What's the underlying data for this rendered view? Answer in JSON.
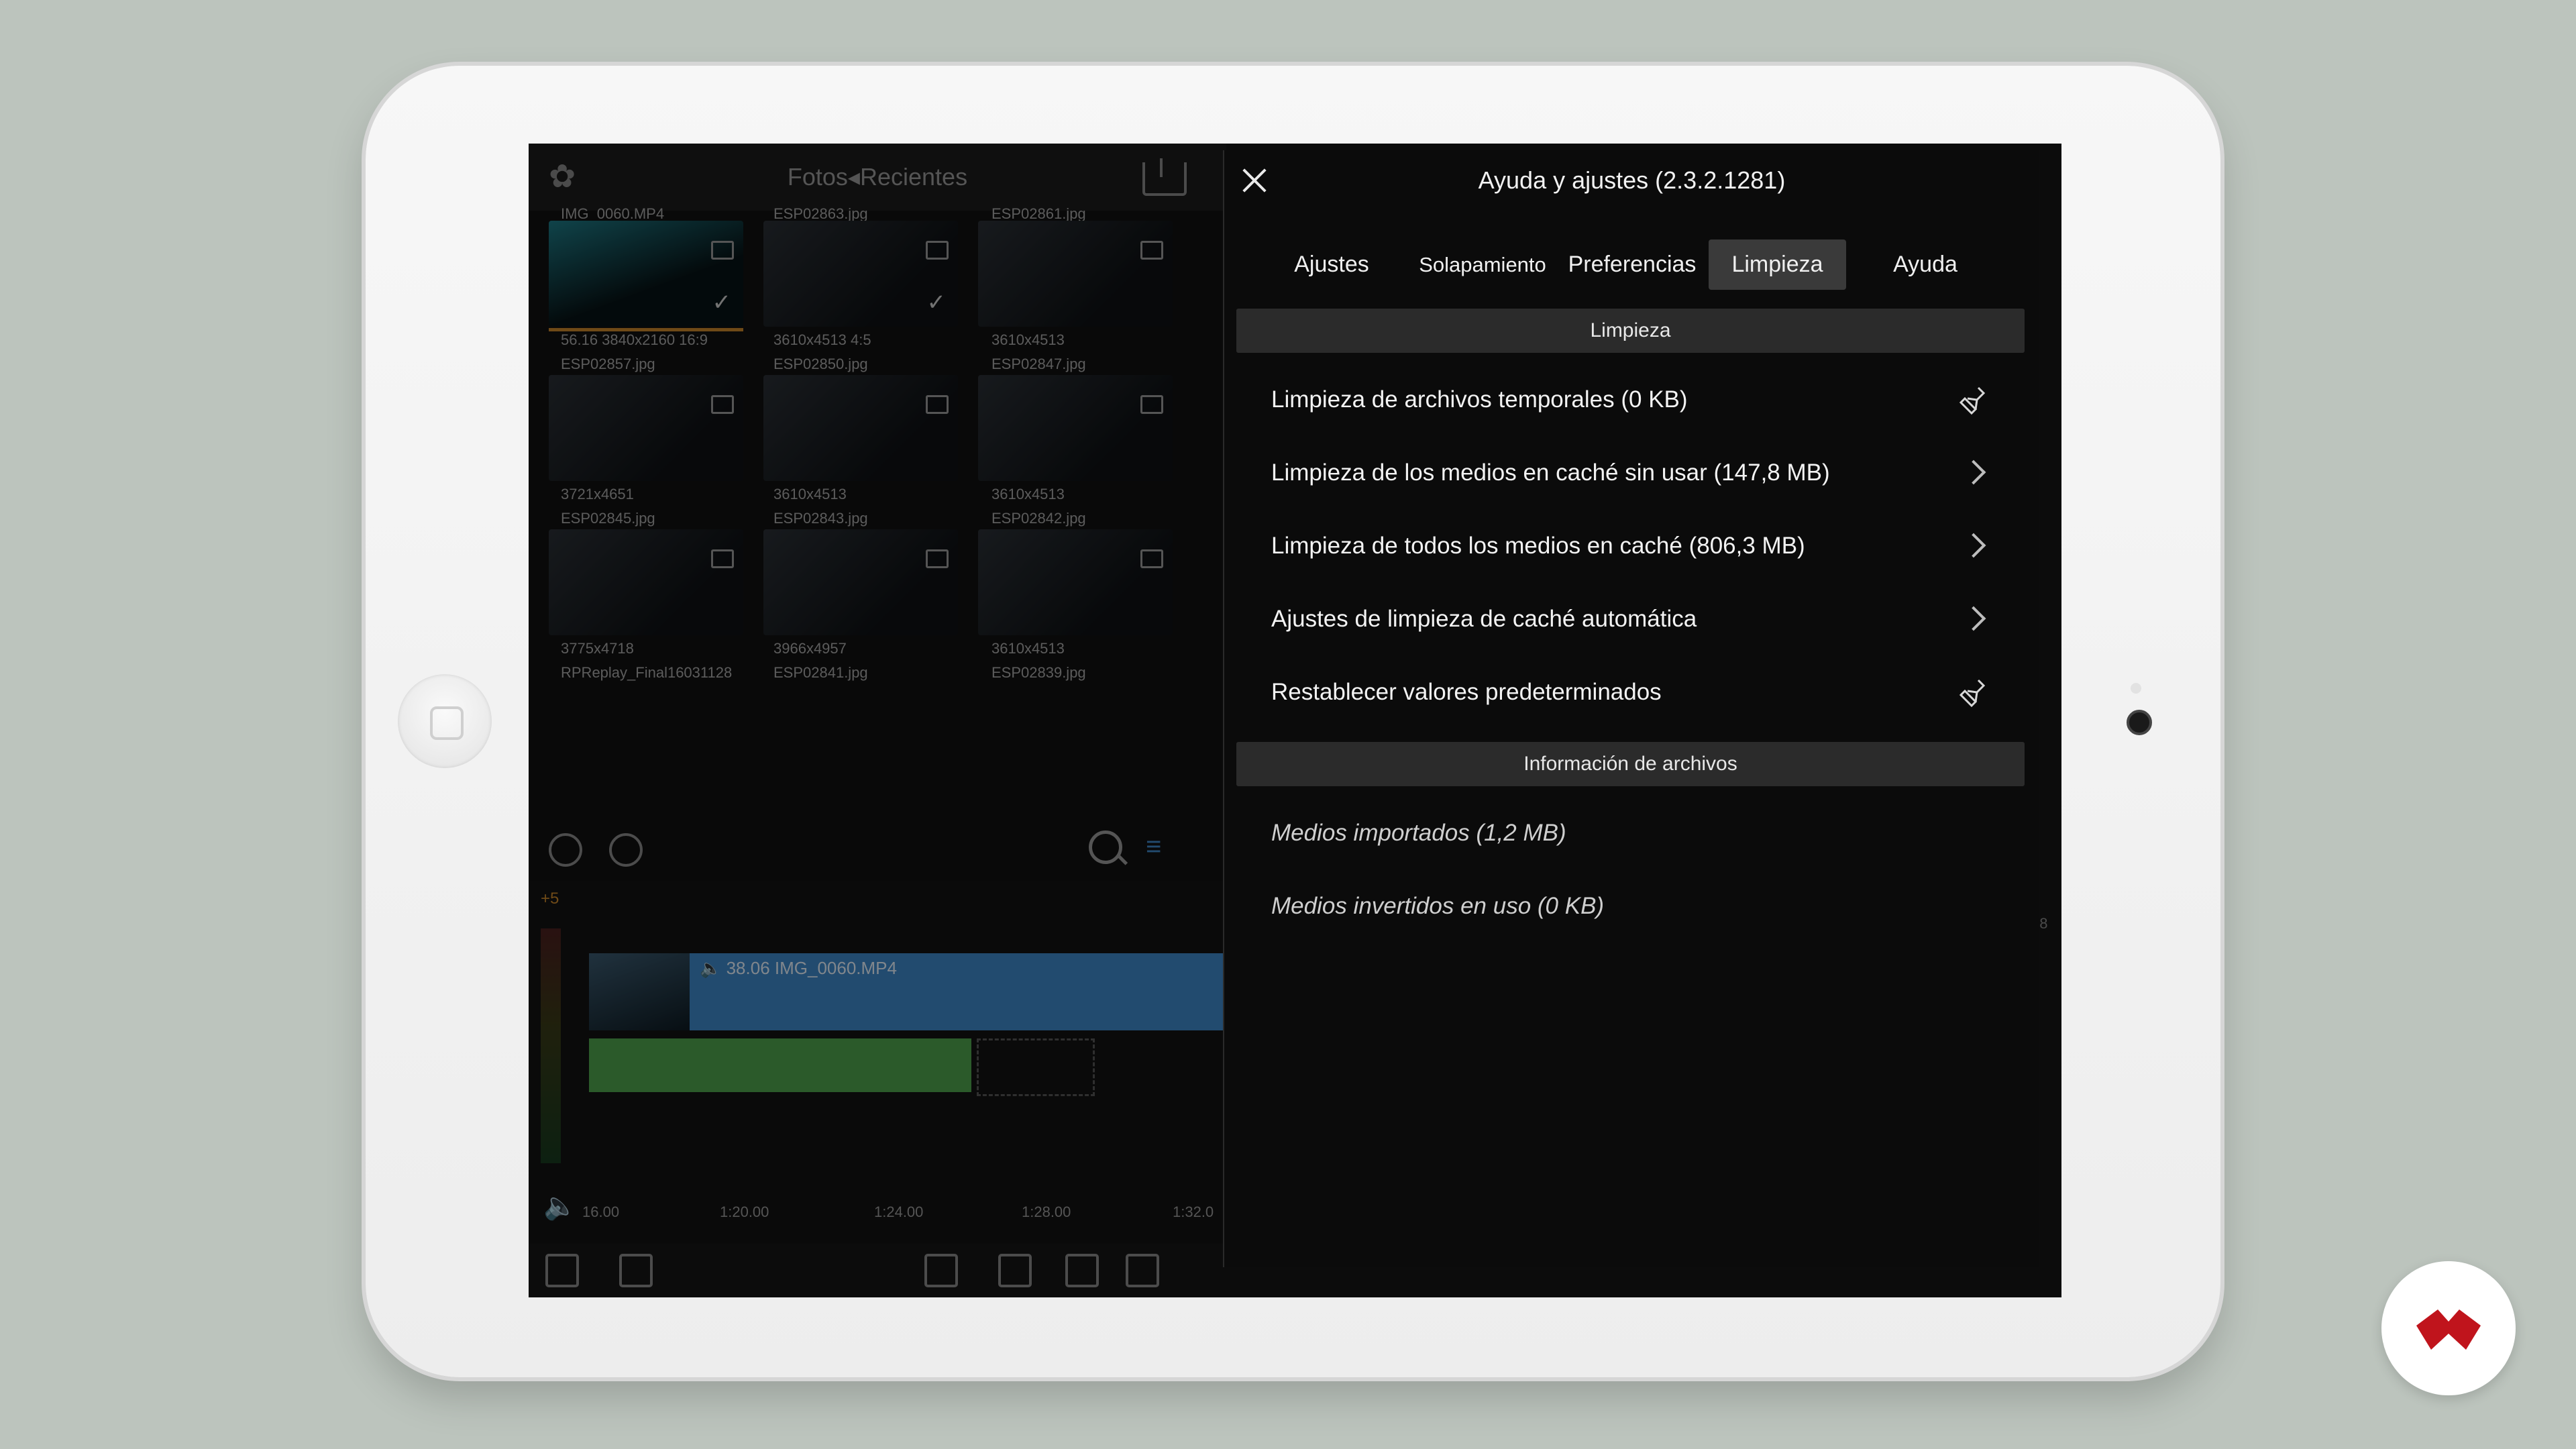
{
  "browser": {
    "title": "Fotos◂Recientes",
    "thumbnails": [
      {
        "name": "IMG_0060.MP4",
        "info": "56.16  3840x2160  16:9",
        "checked": true
      },
      {
        "name": "ESP02863.jpg",
        "info": "3610x4513  4:5",
        "checked": true
      },
      {
        "name": "ESP02861.jpg",
        "info": "3610x4513",
        "checked": false
      },
      {
        "name": "ESP02857.jpg",
        "info": "3721x4651",
        "checked": false
      },
      {
        "name": "ESP02850.jpg",
        "info": "3610x4513",
        "checked": false
      },
      {
        "name": "ESP02847.jpg",
        "info": "3610x4513",
        "checked": false
      },
      {
        "name": "ESP02845.jpg",
        "info": "3775x4718",
        "checked": false
      },
      {
        "name": "ESP02843.jpg",
        "info": "3966x4957",
        "checked": false
      },
      {
        "name": "ESP02842.jpg",
        "info": "3610x4513",
        "checked": false
      },
      {
        "name": "RPReplay_Final16031128",
        "info": "",
        "checked": false
      },
      {
        "name": "ESP02841.jpg",
        "info": "",
        "checked": false
      },
      {
        "name": "ESP02839.jpg",
        "info": "",
        "checked": false
      }
    ]
  },
  "timeline": {
    "meter_label": "+5",
    "video_clip_label": "🔈 38.06   IMG_0060.MP4",
    "ruler_ticks": [
      "16.00",
      "1:20.00",
      "1:24.00",
      "1:28.00",
      "1:32.0"
    ],
    "right_edge_label": "08"
  },
  "settings": {
    "title": "Ayuda y ajustes (2.3.2.1281)",
    "tabs": [
      {
        "label": "Ajustes",
        "active": false
      },
      {
        "label": "Solapamiento",
        "active": false
      },
      {
        "label": "Preferencias",
        "active": false
      },
      {
        "label": "Limpieza",
        "active": true
      },
      {
        "label": "Ayuda",
        "active": false
      }
    ],
    "section_cleanup": "Limpieza",
    "cleanup_rows": [
      {
        "label": "Limpieza de archivos temporales (0 KB)",
        "icon": "broom-icon"
      },
      {
        "label": "Limpieza de los medios en caché sin usar (147,8 MB)",
        "icon": "chevron-right-icon"
      },
      {
        "label": "Limpieza de todos los medios en caché (806,3 MB)",
        "icon": "chevron-right-icon"
      },
      {
        "label": "Ajustes de limpieza de caché automática",
        "icon": "chevron-right-icon"
      },
      {
        "label": "Restablecer valores predeterminados",
        "icon": "broom-icon"
      }
    ],
    "section_files": "Información de archivos",
    "file_rows": [
      {
        "label": "Medios importados (1,2 MB)"
      },
      {
        "label": "Medios invertidos en uso (0 KB)"
      }
    ]
  },
  "colors": {
    "accent_blue": "#3d88c9",
    "audio_green": "#4fa34c",
    "logo_red": "#c0141c"
  }
}
